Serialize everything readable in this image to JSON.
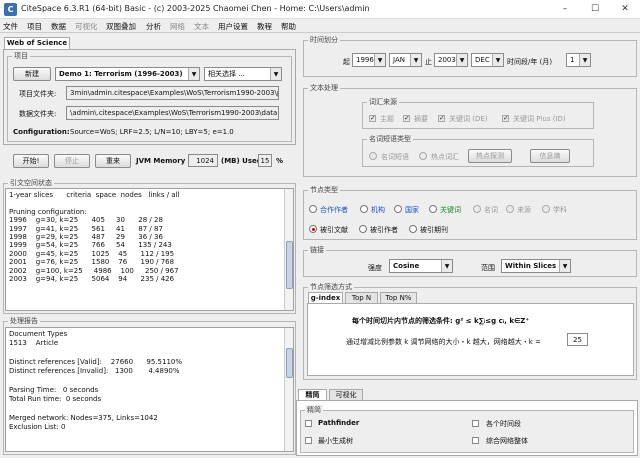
{
  "window": {
    "title": "CiteSpace 6.3.R1 (64-bit) Basic - (c) 2003-2025 Chaomei Chen - Home: C:\\Users\\admin",
    "icon_letter": "C"
  },
  "menu": [
    "文件",
    "项目",
    "数据",
    "可视化",
    "双图叠加",
    "分析",
    "网络",
    "文本",
    "用户设置",
    "教程",
    "帮助"
  ],
  "project": {
    "tab": "Web of Science",
    "group_title": "项目",
    "new_button": "新建",
    "project_name": "Demo 1: Terrorism (1996-2003)",
    "action_select": "相关选择 ...",
    "project_dir_label": "项目文件夹:",
    "project_dir": "3min\\admin.citespace\\Examples\\WoS\\Terrorism1990-2003\\project",
    "data_dir_label": "数据文件夹:",
    "data_dir": "\\admin\\.citespace\\Examples\\WoS\\Terrorism1990-2003\\data",
    "config_label": "Configuration:",
    "config_value": "Source=WoS; LRF=2.5; L/N=10; LBY=5; e=1.0"
  },
  "controls": {
    "start": "开始!",
    "stop": "停止",
    "reset": "重来",
    "jvm_label": "JVM Memory",
    "jvm_value": "1024",
    "mb_used": "(MB) Used",
    "used_value": "15",
    "percent": "%"
  },
  "space_status": {
    "title": "引文空间状态",
    "text": "1-year slices      criteria  space  nodes   links / all\n\nPruning configuration:\n1996    g=30, k=25      405     30      28 / 28\n1997    g=41, k=25      561     41      87 / 87\n1998    g=29, k=25      487     29      36 / 36\n1999    g=54, k=25      766     54      135 / 243\n2000    g=45, k=25      1025    45      112 / 195\n2001    g=76, k=25      1580    76      190 / 768\n2002    g=100, k=25     4986    100     250 / 967\n2003    g=94, k=25      5064    94      235 / 426"
  },
  "process_report": {
    "title": "处理报告",
    "text": "Document Types\n1513    Article\n\nDistinct references [Valid]:    27660      95.5110%\nDistinct references [Invalid]:   1300       4.4890%\n\nParsing Time:   0 seconds\nTotal Run time:  0 seconds\n\nMerged network: Nodes=375, Links=1042\nExclusion List: 0"
  },
  "time_slicing": {
    "title": "时间划分",
    "from_label": "起",
    "from_year": "1996",
    "from_month": "JAN",
    "to_label": "止",
    "to_year": "2003",
    "to_month": "DEC",
    "slice_label": "时间段/年 (月)",
    "slice_value": "1"
  },
  "text_processing": {
    "title": "文本处理",
    "term_source_title": "词汇来源",
    "term_sources": [
      {
        "label": "主题",
        "checked": true
      },
      {
        "label": "摘要",
        "checked": true
      },
      {
        "label": "关键词 (DE)",
        "checked": true
      },
      {
        "label": "关键词 Plus (ID)",
        "checked": true
      }
    ],
    "term_type_title": "名词短语类型",
    "term_types": [
      "名词短语",
      "热点词汇"
    ],
    "burst_button": "热点探测",
    "entropy_button": "信息熵"
  },
  "node_types": {
    "title": "节点类型",
    "row1": [
      "合作作者",
      "机构",
      "国家",
      "关键词",
      "名词",
      "来源",
      "学科"
    ],
    "row2": [
      "被引文献",
      "被引作者",
      "被引期刊"
    ],
    "selected": "被引文献"
  },
  "links": {
    "title": "链接",
    "strength_label": "强度",
    "strength_value": "Cosine",
    "scope_label": "范围",
    "scope_value": "Within Slices"
  },
  "selection": {
    "title": "节点筛选方式",
    "tabs": [
      "g-index",
      "Top N",
      "Top N%"
    ],
    "formula_text": "每个时间切片内节点的筛选条件: g² ≤ k∑ᵢ≤g cᵢ, k∈Z⁺",
    "scale_text": "通过增减比例参数 k 调节网络的大小・k 越大，网络越大・k =",
    "k_value": "25"
  },
  "pruning": {
    "tabs": [
      "精简",
      "可视化"
    ],
    "group_title": "精简",
    "options": [
      "Pathfinder",
      "各个时间段",
      "最小生成树",
      "综合网络整体"
    ]
  },
  "colors": {
    "accent": "#1f4fd1",
    "green": "#168a2d",
    "radio_dot": "#cc0000"
  }
}
